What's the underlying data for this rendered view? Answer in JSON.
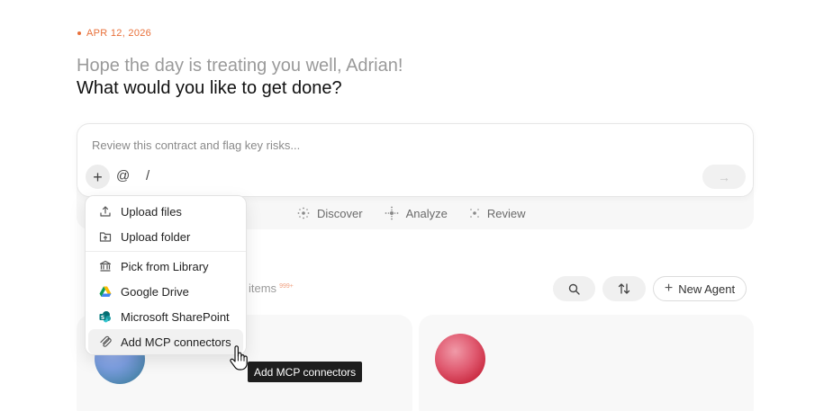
{
  "header": {
    "date": "APR 12, 2026",
    "greeting": "Hope the day is treating you well, Adrian!",
    "question": "What would you like to get done?"
  },
  "composer": {
    "placeholder": "Review this contract and flag key risks...",
    "plus_label": "+",
    "at_label": "@",
    "slash_label": "/",
    "send_label": "→"
  },
  "chips": [
    {
      "label": "Discover",
      "icon": "discover-icon"
    },
    {
      "label": "Analyze",
      "icon": "analyze-icon"
    },
    {
      "label": "Review",
      "icon": "review-icon"
    }
  ],
  "attach_menu": {
    "items": [
      {
        "label": "Upload files",
        "icon": "upload-icon"
      },
      {
        "label": "Upload folder",
        "icon": "folder-upload-icon"
      },
      {
        "label": "Pick from Library",
        "icon": "library-icon"
      },
      {
        "label": "Google Drive",
        "icon": "google-drive-icon"
      },
      {
        "label": "Microsoft SharePoint",
        "icon": "sharepoint-icon"
      },
      {
        "label": "Add MCP connectors",
        "icon": "mcp-icon"
      }
    ],
    "tooltip": "Add MCP connectors"
  },
  "toolbar": {
    "items_label": "items",
    "items_badge": "999+",
    "new_agent_label": "New Agent"
  },
  "colors": {
    "accent": "#e8703a",
    "tooltip_bg": "#1e1e1e"
  }
}
